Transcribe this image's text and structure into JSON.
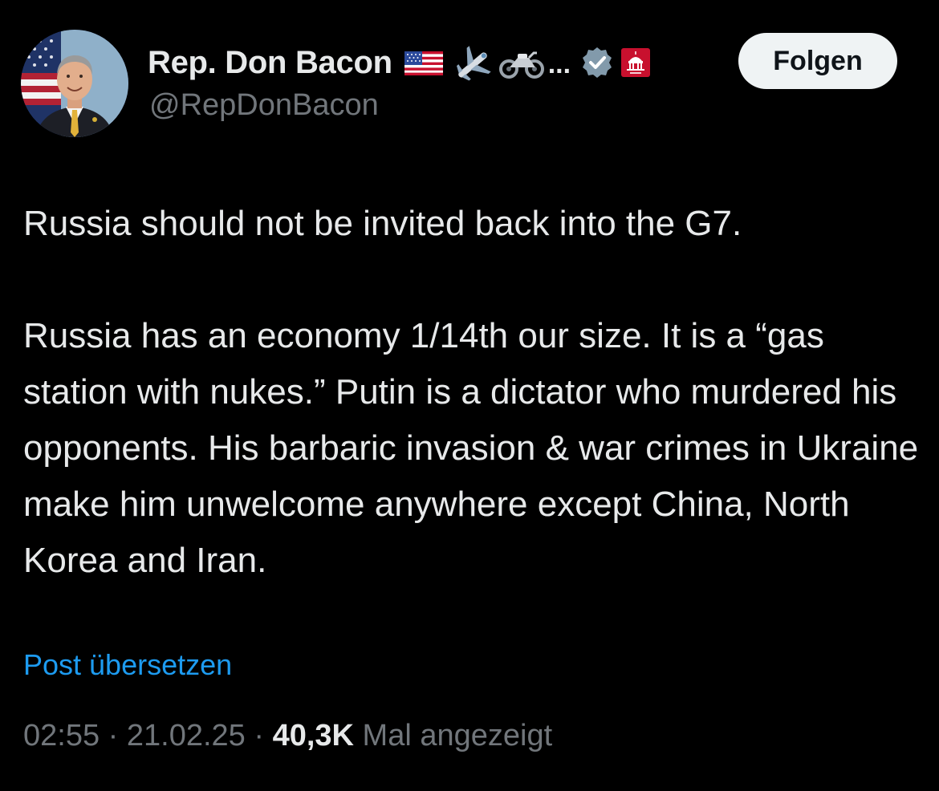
{
  "author": {
    "display_name": "Rep. Don Bacon",
    "handle": "@RepDonBacon",
    "name_emoji": [
      "us-flag-emoji",
      "airplane-emoji",
      "motorcycle-emoji"
    ],
    "name_overflow": "...",
    "badges": [
      "verified-gray-icon",
      "house-gop-badge-icon"
    ]
  },
  "follow_label": "Folgen",
  "tweet": {
    "paragraph1": "Russia should not be invited back into the G7.",
    "paragraph2": "Russia has an economy 1/14th our size. It is a “gas station with nukes.” Putin is a dictator who murdered his opponents. His barbaric invasion & war crimes in Ukraine make him unwelcome anywhere except China, North Korea and Iran."
  },
  "translate_label": "Post übersetzen",
  "meta": {
    "time": "02:55",
    "separator": "·",
    "date": "21.02.25",
    "views": "40,3K",
    "views_label": "Mal angezeigt"
  },
  "colors": {
    "background": "#000000",
    "text_primary": "#e7e9ea",
    "text_secondary": "#71767b",
    "link": "#1d9bf0",
    "follow_button_bg": "#eff3f4",
    "verified_badge": "#829aab",
    "gop_badge": "#c8102e"
  }
}
